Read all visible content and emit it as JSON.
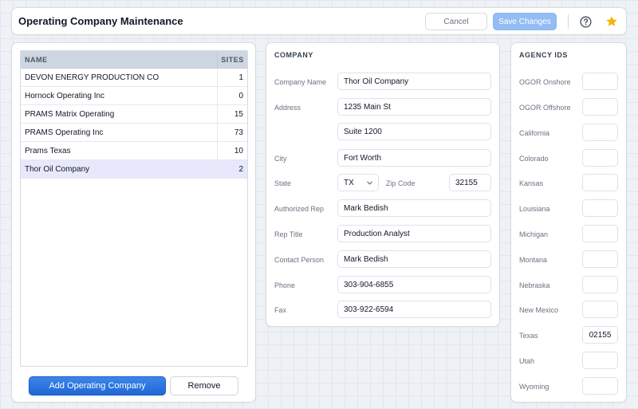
{
  "header": {
    "title": "Operating Company Maintenance",
    "cancel_label": "Cancel",
    "save_label": "Save Changes"
  },
  "list": {
    "col_name": "NAME",
    "col_sites": "SITES",
    "rows": [
      {
        "name": "DEVON ENERGY PRODUCTION CO",
        "sites": "1"
      },
      {
        "name": "Hornock Operating Inc",
        "sites": "0"
      },
      {
        "name": "PRAMS Matrix Operating",
        "sites": "15"
      },
      {
        "name": "PRAMS Operating Inc",
        "sites": "73"
      },
      {
        "name": "Prams Texas",
        "sites": "10"
      },
      {
        "name": "Thor Oil Company",
        "sites": "2"
      }
    ],
    "selected_index": 5,
    "add_label": "Add Operating Company",
    "remove_label": "Remove"
  },
  "company": {
    "section_title": "COMPANY",
    "labels": {
      "company_name": "Company Name",
      "address": "Address",
      "city": "City",
      "state": "State",
      "zip": "Zip Code",
      "authorized_rep": "Authorized Rep",
      "rep_title": "Rep Title",
      "contact_person": "Contact Person",
      "phone": "Phone",
      "fax": "Fax"
    },
    "values": {
      "company_name": "Thor Oil Company",
      "address1": "1235 Main St",
      "address2": "Suite 1200",
      "city": "Fort Worth",
      "state": "TX",
      "zip": "32155",
      "authorized_rep": "Mark Bedish",
      "rep_title": "Production Analyst",
      "contact_person": "Mark Bedish",
      "phone": "303-904-6855",
      "fax": "303-922-6594"
    }
  },
  "agency": {
    "section_title": "AGENCY IDS",
    "items": [
      {
        "label": "OGOR Onshore",
        "value": ""
      },
      {
        "label": "OGOR Offshore",
        "value": ""
      },
      {
        "label": "California",
        "value": ""
      },
      {
        "label": "Colorado",
        "value": ""
      },
      {
        "label": "Kansas",
        "value": ""
      },
      {
        "label": "Louisiana",
        "value": ""
      },
      {
        "label": "Michigan",
        "value": ""
      },
      {
        "label": "Montana",
        "value": ""
      },
      {
        "label": "Nebraska",
        "value": ""
      },
      {
        "label": "New Mexico",
        "value": ""
      },
      {
        "label": "Texas",
        "value": "02155"
      },
      {
        "label": "Utah",
        "value": ""
      },
      {
        "label": "Wyoming",
        "value": ""
      }
    ]
  },
  "icons": {
    "help": "help-circle-icon",
    "favorite": "star-icon",
    "state_dropdown": "chevron-down-icon"
  },
  "colors": {
    "primary": "#1f67d4",
    "save_disabled": "#93bdf3",
    "star": "#f2b705",
    "selected_row": "#e7e8fb"
  }
}
